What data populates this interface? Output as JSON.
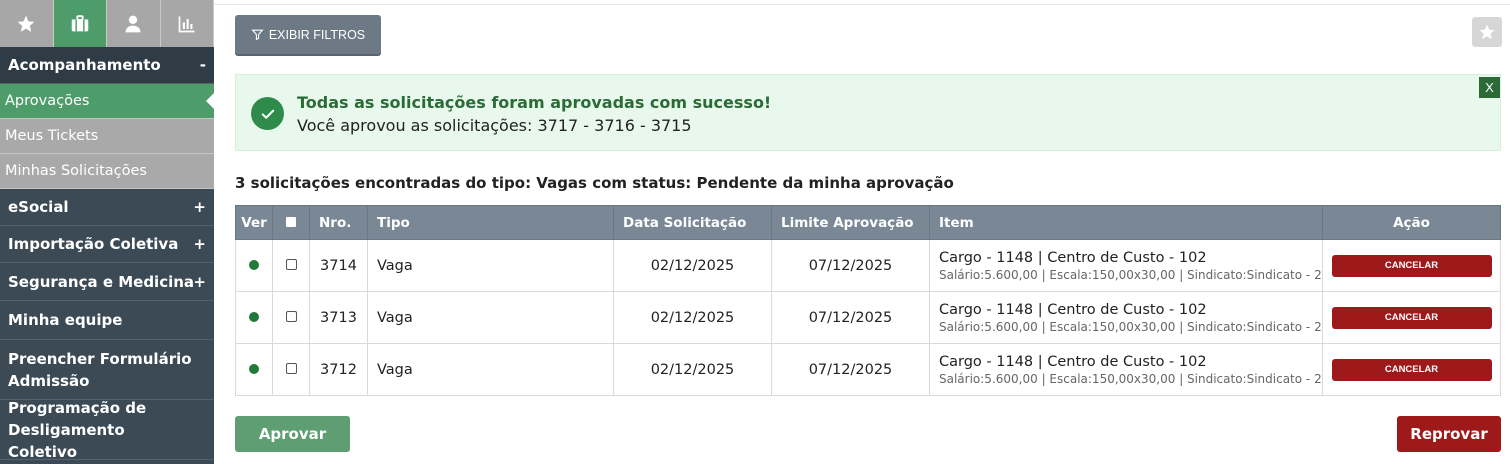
{
  "sidebar": {
    "tabs": [
      {
        "icon": "star-icon"
      },
      {
        "icon": "briefcase-icon"
      },
      {
        "icon": "user-icon"
      },
      {
        "icon": "bar-chart-icon"
      }
    ],
    "sections": [
      {
        "label": "Acompanhamento",
        "sign": "-"
      },
      {
        "label": "Aprovações"
      },
      {
        "label": "Meus Tickets"
      },
      {
        "label": "Minhas Solicitações"
      },
      {
        "label": "eSocial",
        "sign": "+"
      },
      {
        "label": "Importação Coletiva",
        "sign": "+"
      },
      {
        "label": "Segurança e Medicina",
        "sign": "+"
      },
      {
        "label": "Minha equipe"
      },
      {
        "label": "Preencher Formulário Admissão"
      },
      {
        "label": "Programação de Desligamento Coletivo"
      }
    ]
  },
  "toolbar": {
    "filter_label": "EXIBIR FILTROS"
  },
  "alert": {
    "title": "Todas as solicitações foram aprovadas com sucesso!",
    "message": "Você aprovou as solicitações: 3717 - 3716 - 3715",
    "close_label": "X"
  },
  "summary": "3 solicitações encontradas do tipo: Vagas com status: Pendente da minha aprovação",
  "table": {
    "headers": {
      "ver": "Ver",
      "nro": "Nro.",
      "tipo": "Tipo",
      "data": "Data Solicitação",
      "limite": "Limite Aprovação",
      "item": "Item",
      "acao": "Ação"
    },
    "rows": [
      {
        "nro": "3714",
        "tipo": "Vaga",
        "data": "02/12/2025",
        "limite": "07/12/2025",
        "item_main": "Cargo - 1148 | Centro de Custo - 102",
        "item_sub": "Salário:5.600,00 | Escala:150,00x30,00 | Sindicato:Sindicato - 2",
        "action": "CANCELAR"
      },
      {
        "nro": "3713",
        "tipo": "Vaga",
        "data": "02/12/2025",
        "limite": "07/12/2025",
        "item_main": "Cargo - 1148 | Centro de Custo - 102",
        "item_sub": "Salário:5.600,00 | Escala:150,00x30,00 | Sindicato:Sindicato - 2",
        "action": "CANCELAR"
      },
      {
        "nro": "3712",
        "tipo": "Vaga",
        "data": "02/12/2025",
        "limite": "07/12/2025",
        "item_main": "Cargo - 1148 | Centro de Custo - 102",
        "item_sub": "Salário:5.600,00 | Escala:150,00x30,00 | Sindicato:Sindicato - 2",
        "action": "CANCELAR"
      }
    ]
  },
  "buttons": {
    "approve": "Aprovar",
    "reject": "Reprovar"
  },
  "colors": {
    "sidebar_bg": "#3c4a55",
    "accent_green": "#4f9c6b",
    "danger_red": "#9e1a1a",
    "table_header": "#7a8896"
  }
}
